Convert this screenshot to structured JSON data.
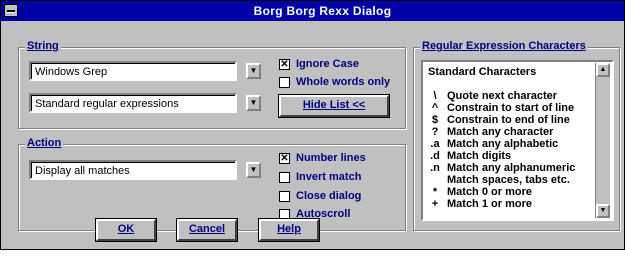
{
  "window": {
    "title": "Borg Borg Rexx Dialog"
  },
  "string_group": {
    "label": "String",
    "search_value": "Windows Grep",
    "mode_value": "Standard regular expressions",
    "ignore_case": {
      "label": "Ignore Case",
      "checked": true
    },
    "whole_words": {
      "label": "Whole words only",
      "checked": false
    },
    "hide_button": "Hide List <<"
  },
  "action_group": {
    "label": "Action",
    "action_value": "Display all matches",
    "options": [
      {
        "label": "Number lines",
        "checked": true
      },
      {
        "label": "Invert match",
        "checked": false
      },
      {
        "label": "Close dialog",
        "checked": false
      },
      {
        "label": "Autoscroll",
        "checked": false
      }
    ]
  },
  "regex_group": {
    "label": "Regular Expression Characters",
    "category_value": "Standard Characters",
    "items": [
      {
        "sym": "\\",
        "desc": "Quote next character"
      },
      {
        "sym": "^",
        "desc": "Constrain to start of line"
      },
      {
        "sym": "$",
        "desc": "Constrain to end of line"
      },
      {
        "sym": "?",
        "desc": "Match any character"
      },
      {
        "sym": ".a",
        "desc": "Match any alphabetic"
      },
      {
        "sym": ".d",
        "desc": "Match digits"
      },
      {
        "sym": ".n",
        "desc": "Match any alphanumeric"
      },
      {
        "sym": " ",
        "desc": "Match spaces, tabs etc."
      },
      {
        "sym": "*",
        "desc": "Match 0 or more"
      },
      {
        "sym": "+",
        "desc": "Match 1 or more"
      }
    ]
  },
  "buttons": {
    "ok": "OK",
    "cancel": "Cancel",
    "help": "Help"
  }
}
